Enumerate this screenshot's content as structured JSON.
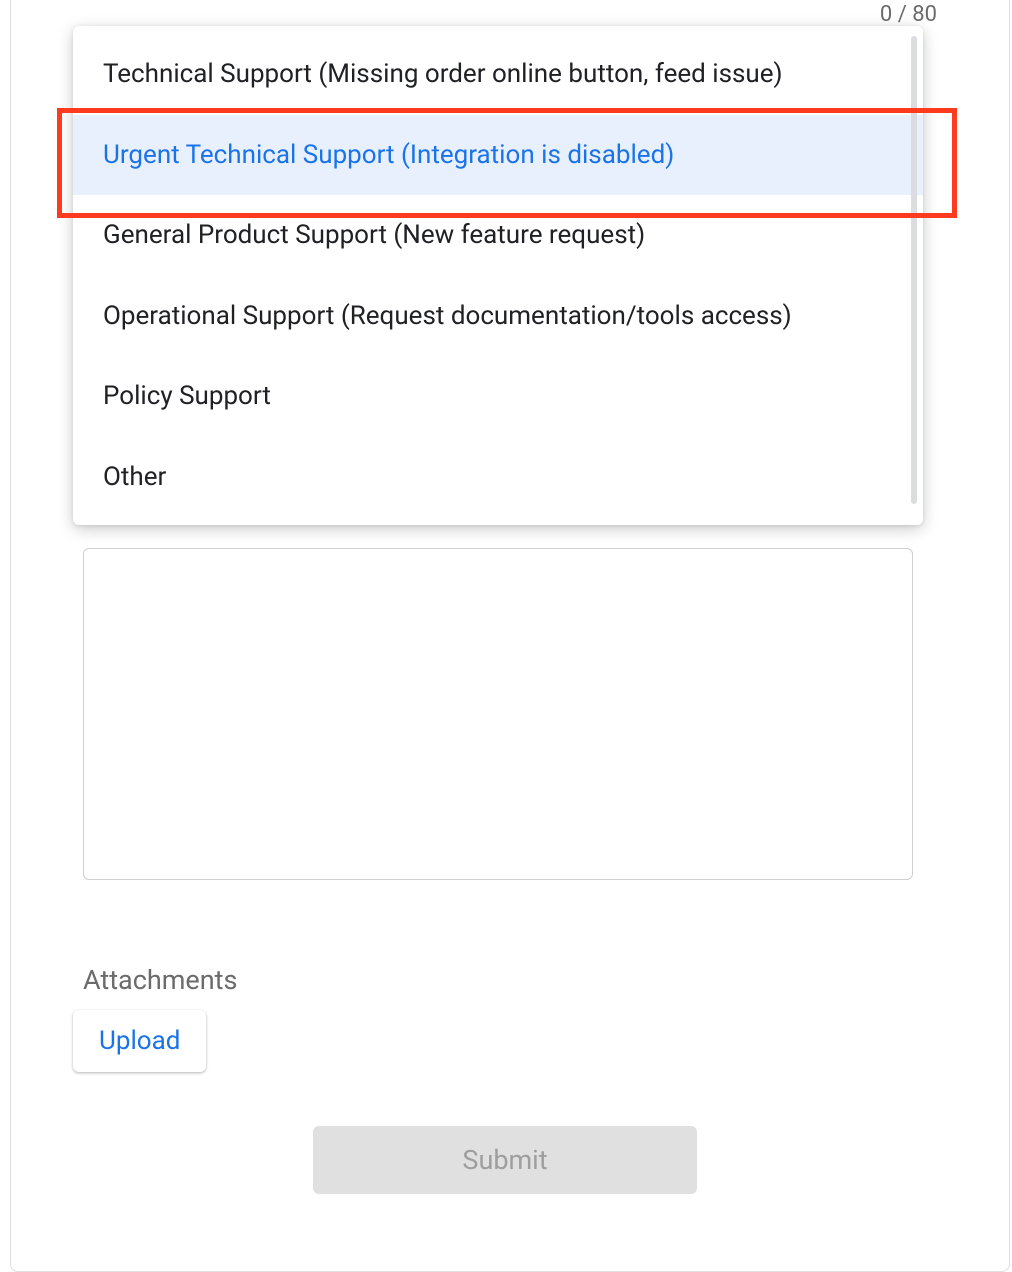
{
  "counter": "0 / 80",
  "dropdown": {
    "items": [
      {
        "label": "Technical Support (Missing order online button, feed issue)",
        "highlighted": false
      },
      {
        "label": "Urgent Technical Support (Integration is disabled)",
        "highlighted": true
      },
      {
        "label": "General Product Support (New feature request)",
        "highlighted": false
      },
      {
        "label": "Operational Support (Request documentation/tools access)",
        "highlighted": false
      },
      {
        "label": "Policy Support",
        "highlighted": false
      },
      {
        "label": "Other",
        "highlighted": false
      }
    ]
  },
  "attachments_label": "Attachments",
  "upload_label": "Upload",
  "submit_label": "Submit"
}
